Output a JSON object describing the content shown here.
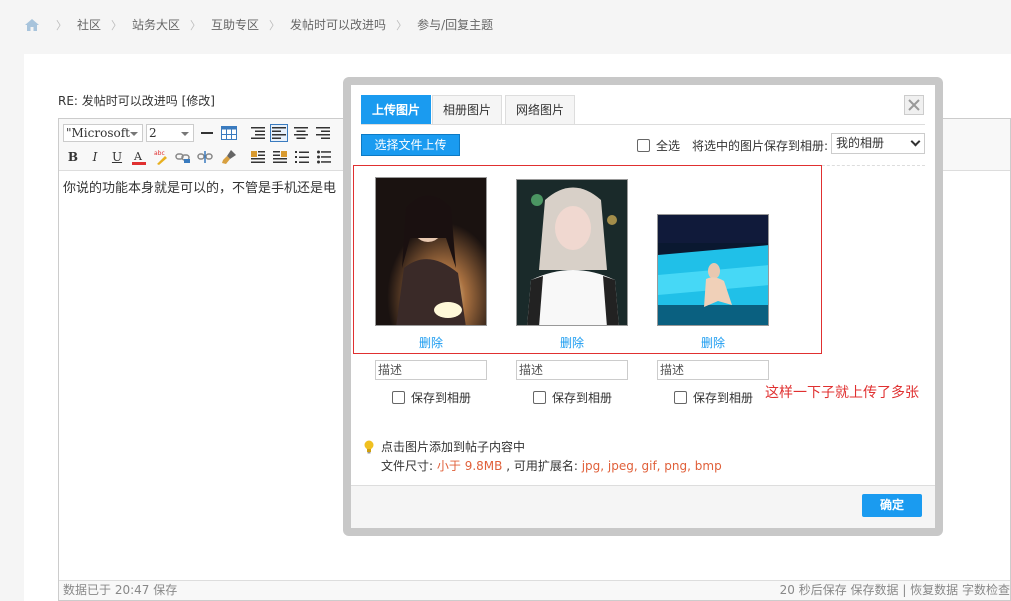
{
  "breadcrumb": {
    "items": [
      "社区",
      "站务大区",
      "互助专区",
      "发帖时可以改进吗",
      "参与/回复主题"
    ]
  },
  "post": {
    "title": "RE: 发帖时可以改进吗 [修改]"
  },
  "editor": {
    "font_name": "\"Microsoft",
    "font_size": "2",
    "content": "你说的功能本身就是可以的，不管是手机还是电",
    "status_left": "数据已于 20:47 保存",
    "status_right": "20 秒后保存 保存数据 | 恢复数据    字数检查"
  },
  "dialog": {
    "tabs": [
      "上传图片",
      "相册图片",
      "网络图片"
    ],
    "active_tab": 0,
    "choose_button": "选择文件上传",
    "select_all": "全选",
    "save_selected_label": "将选中的图片保存到相册:",
    "album_selected": "我的相册",
    "photos": [
      {
        "delete_label": "删除",
        "description_placeholder": "描述",
        "save_label": "保存到相册"
      },
      {
        "delete_label": "删除",
        "description_placeholder": "描述",
        "save_label": "保存到相册"
      },
      {
        "delete_label": "删除",
        "description_placeholder": "描述",
        "save_label": "保存到相册"
      }
    ],
    "annotation": "这样一下子就上传了多张",
    "tip": "点击图片添加到帖子内容中",
    "file_size_label": "文件尺寸:",
    "file_size_value": "小于 9.8MB",
    "ext_label": ", 可用扩展名:",
    "ext_value": "jpg, jpeg, gif, png, bmp",
    "ok_button": "确定"
  },
  "colors": {
    "accent": "#1a9bf0",
    "annotation_red": "#e03030",
    "highlight_orange": "#e0603a"
  }
}
